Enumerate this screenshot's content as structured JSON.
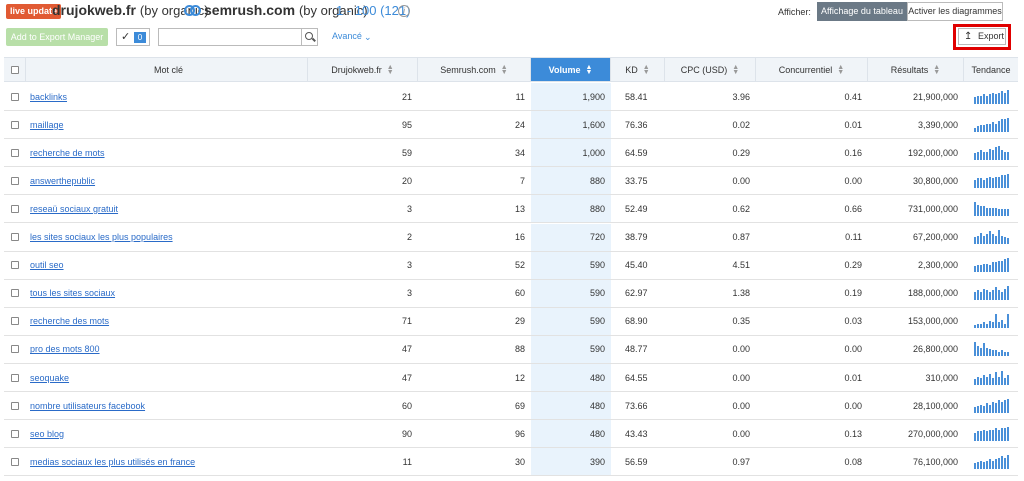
{
  "header": {
    "badge": "live update",
    "domain1": "drujokweb.fr",
    "domain1_sub": "(by organic)",
    "domain2": "semrush.com",
    "domain2_sub": "(by organic)",
    "range": "1 - 100 (121)",
    "info_icon": "i",
    "afficher_label": "Afficher:",
    "view_table": "Affichage du tableau",
    "view_charts": "Activer les diagrammes"
  },
  "toolbar": {
    "add_export": "Add to Export Manager",
    "check_icon": "✓",
    "selected_count": "0",
    "search_placeholder": "",
    "search_value": "",
    "advanced": "Avancé",
    "export_label": "Export"
  },
  "colors": {
    "accent": "#3c8bd9",
    "badge": "#e15a33",
    "highlight": "#e00000",
    "add_button": "#b8dfa8"
  },
  "table": {
    "columns": [
      "Mot clé",
      "Drujokweb.fr",
      "Semrush.com",
      "Volume",
      "KD",
      "CPC (USD)",
      "Concurrentiel",
      "Résultats",
      "Tendance"
    ],
    "sorted_column": "Volume",
    "rows": [
      {
        "kw": "backlinks",
        "d": "21",
        "s": "11",
        "v": "1,900",
        "kd": "58.41",
        "cpc": "3.96",
        "con": "0.41",
        "res": "21,900,000",
        "trend": [
          0.5,
          0.6,
          0.6,
          0.7,
          0.6,
          0.7,
          0.8,
          0.7,
          0.8,
          0.9,
          0.8,
          1.0
        ]
      },
      {
        "kw": "maillage",
        "d": "95",
        "s": "24",
        "v": "1,600",
        "kd": "76.36",
        "cpc": "0.02",
        "con": "0.01",
        "res": "3,390,000",
        "trend": [
          0.3,
          0.4,
          0.5,
          0.5,
          0.6,
          0.6,
          0.7,
          0.6,
          0.8,
          0.9,
          0.9,
          1.0
        ]
      },
      {
        "kw": "recherche de mots",
        "d": "59",
        "s": "34",
        "v": "1,000",
        "kd": "64.59",
        "cpc": "0.29",
        "con": "0.16",
        "res": "192,000,000",
        "trend": [
          0.5,
          0.6,
          0.7,
          0.6,
          0.6,
          0.8,
          0.7,
          0.9,
          1.0,
          0.7,
          0.6,
          0.6
        ]
      },
      {
        "kw": "answerthepublic",
        "d": "20",
        "s": "7",
        "v": "880",
        "kd": "33.75",
        "cpc": "0.00",
        "con": "0.00",
        "res": "30,800,000",
        "trend": [
          0.6,
          0.7,
          0.7,
          0.6,
          0.7,
          0.8,
          0.7,
          0.8,
          0.8,
          0.9,
          0.9,
          1.0
        ]
      },
      {
        "kw": "reseaü sociaux gratuit",
        "d": "3",
        "s": "13",
        "v": "880",
        "kd": "52.49",
        "cpc": "0.62",
        "con": "0.66",
        "res": "731,000,000",
        "trend": [
          1.0,
          0.8,
          0.7,
          0.7,
          0.6,
          0.6,
          0.6,
          0.6,
          0.5,
          0.5,
          0.5,
          0.5
        ]
      },
      {
        "kw": "les sites sociaux les plus populaires",
        "d": "2",
        "s": "16",
        "v": "720",
        "kd": "38.79",
        "cpc": "0.87",
        "con": "0.11",
        "res": "67,200,000",
        "trend": [
          0.5,
          0.6,
          0.8,
          0.6,
          0.7,
          0.9,
          0.7,
          0.6,
          1.0,
          0.6,
          0.5,
          0.4
        ]
      },
      {
        "kw": "outil seo",
        "d": "3",
        "s": "52",
        "v": "590",
        "kd": "45.40",
        "cpc": "4.51",
        "con": "0.29",
        "res": "2,300,000",
        "trend": [
          0.4,
          0.5,
          0.5,
          0.6,
          0.6,
          0.5,
          0.7,
          0.7,
          0.8,
          0.8,
          0.9,
          1.0
        ]
      },
      {
        "kw": "tous les sites sociaux",
        "d": "3",
        "s": "60",
        "v": "590",
        "kd": "62.97",
        "cpc": "1.38",
        "con": "0.19",
        "res": "188,000,000",
        "trend": [
          0.6,
          0.7,
          0.6,
          0.8,
          0.7,
          0.6,
          0.7,
          0.9,
          0.7,
          0.6,
          0.8,
          1.0
        ]
      },
      {
        "kw": "recherche des mots",
        "d": "71",
        "s": "29",
        "v": "590",
        "kd": "68.90",
        "cpc": "0.35",
        "con": "0.03",
        "res": "153,000,000",
        "trend": [
          0.2,
          0.3,
          0.3,
          0.4,
          0.3,
          0.5,
          0.4,
          1.0,
          0.4,
          0.6,
          0.3,
          1.0
        ]
      },
      {
        "kw": "pro des mots 800",
        "d": "47",
        "s": "88",
        "v": "590",
        "kd": "48.77",
        "cpc": "0.00",
        "con": "0.00",
        "res": "26,800,000",
        "trend": [
          1.0,
          0.7,
          0.6,
          0.9,
          0.6,
          0.5,
          0.4,
          0.4,
          0.3,
          0.4,
          0.3,
          0.3
        ]
      },
      {
        "kw": "seoquake",
        "d": "47",
        "s": "12",
        "v": "480",
        "kd": "64.55",
        "cpc": "0.00",
        "con": "0.01",
        "res": "310,000",
        "trend": [
          0.4,
          0.6,
          0.5,
          0.7,
          0.6,
          0.8,
          0.5,
          0.9,
          0.6,
          1.0,
          0.5,
          0.7
        ]
      },
      {
        "kw": "nombre utilisateurs facebook",
        "d": "60",
        "s": "69",
        "v": "480",
        "kd": "73.66",
        "cpc": "0.00",
        "con": "0.00",
        "res": "28,100,000",
        "trend": [
          0.4,
          0.5,
          0.6,
          0.5,
          0.7,
          0.6,
          0.8,
          0.7,
          0.9,
          0.8,
          0.9,
          1.0
        ]
      },
      {
        "kw": "seo blog",
        "d": "90",
        "s": "96",
        "v": "480",
        "kd": "43.43",
        "cpc": "0.00",
        "con": "0.13",
        "res": "270,000,000",
        "trend": [
          0.6,
          0.7,
          0.7,
          0.8,
          0.7,
          0.8,
          0.8,
          0.9,
          0.8,
          0.9,
          0.9,
          1.0
        ]
      },
      {
        "kw": "medias sociaux les plus utilisés en france",
        "d": "11",
        "s": "30",
        "v": "390",
        "kd": "56.59",
        "cpc": "0.97",
        "con": "0.08",
        "res": "76,100,000",
        "trend": [
          0.4,
          0.5,
          0.6,
          0.5,
          0.6,
          0.7,
          0.6,
          0.7,
          0.8,
          0.9,
          0.8,
          1.0
        ]
      }
    ]
  }
}
